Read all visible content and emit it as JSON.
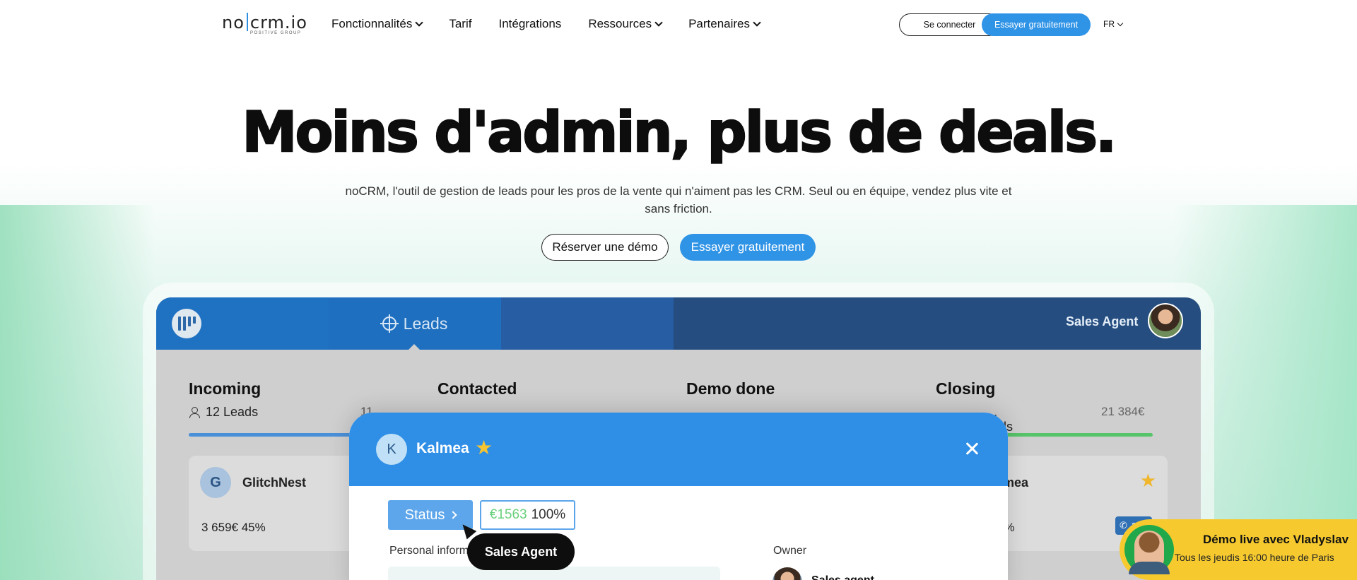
{
  "nav": {
    "logo_text_a": "no",
    "logo_text_b": "crm.io",
    "logo_sub": "POSITIVE GROUP",
    "links": [
      {
        "label": "Fonctionnalités",
        "dropdown": true
      },
      {
        "label": "Tarif",
        "dropdown": false
      },
      {
        "label": "Intégrations",
        "dropdown": false
      },
      {
        "label": "Ressources",
        "dropdown": true
      },
      {
        "label": "Partenaires",
        "dropdown": true
      }
    ],
    "login_label": "Se connecter",
    "try_label": "Essayer gratuitement",
    "lang": "FR"
  },
  "hero": {
    "title": "Moins d'admin, plus de deals.",
    "subtitle": "noCRM, l'outil de gestion de leads pour les pros de la vente qui n'aiment pas les CRM. Seul ou en équipe, vendez plus vite et sans friction.",
    "demo_label": "Réserver une démo",
    "try_label": "Essayer gratuitement"
  },
  "app": {
    "tab_label": "Leads",
    "user_role": "Sales Agent",
    "columns": [
      {
        "title": "Incoming",
        "meta": "12 Leads",
        "amount": "11",
        "progress_color": "#4a90d9"
      },
      {
        "title": "Contacted",
        "meta": "",
        "amount": "",
        "progress_color": ""
      },
      {
        "title": "Demo done",
        "meta": "",
        "amount": "",
        "progress_color": ""
      },
      {
        "title": "Closing",
        "meta": "…eads",
        "amount": "21 384€",
        "progress_color": "#56c46a"
      }
    ],
    "cards": [
      {
        "initial": "G",
        "name": "GlitchNest",
        "value": "3 659€ 45%"
      },
      {
        "name": "…lmea",
        "value": "…8%",
        "badge": "2…"
      }
    ]
  },
  "modal": {
    "initial": "K",
    "name": "Kalmea",
    "status_label": "Status",
    "amount": "€1563",
    "percent": "100%",
    "tooltip": "Sales Agent",
    "personal_info_label": "Personal inform",
    "owner_label": "Owner",
    "owner_name": "Sales agent"
  },
  "demo_widget": {
    "title": "Démo live avec Vladyslav",
    "subtitle": "Tous les jeudis 16:00 heure de Paris"
  },
  "colors": {
    "accent": "#2f93e6",
    "topbar": "#254d80",
    "widget": "#f6ca2f"
  }
}
